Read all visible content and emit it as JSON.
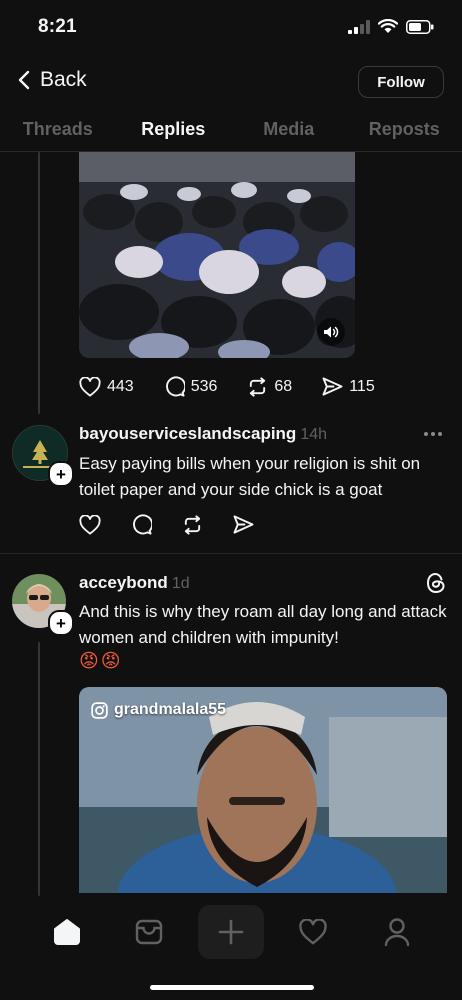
{
  "status_bar": {
    "time": "8:21"
  },
  "nav": {
    "back_label": "Back",
    "follow_label": "Follow"
  },
  "tabs": [
    {
      "label": "Threads",
      "active": false
    },
    {
      "label": "Replies",
      "active": true
    },
    {
      "label": "Media",
      "active": false
    },
    {
      "label": "Reposts",
      "active": false
    }
  ],
  "post1": {
    "likes": "443",
    "comments": "536",
    "reposts": "68",
    "shares": "115"
  },
  "reply1": {
    "username": "bayouserviceslandscaping",
    "time": "14h",
    "text": "Easy paying bills when your religion is shit on toilet paper and your side chick is a goat"
  },
  "reply2": {
    "username": "acceybond",
    "time": "1d",
    "text": "And this is why they roam all day long and attack women and children with impunity!",
    "emojis": "😡😡",
    "media_tag": "grandmalala55"
  },
  "colors": {
    "background": "#101010",
    "text": "#f3f5f7",
    "muted": "#616161"
  }
}
